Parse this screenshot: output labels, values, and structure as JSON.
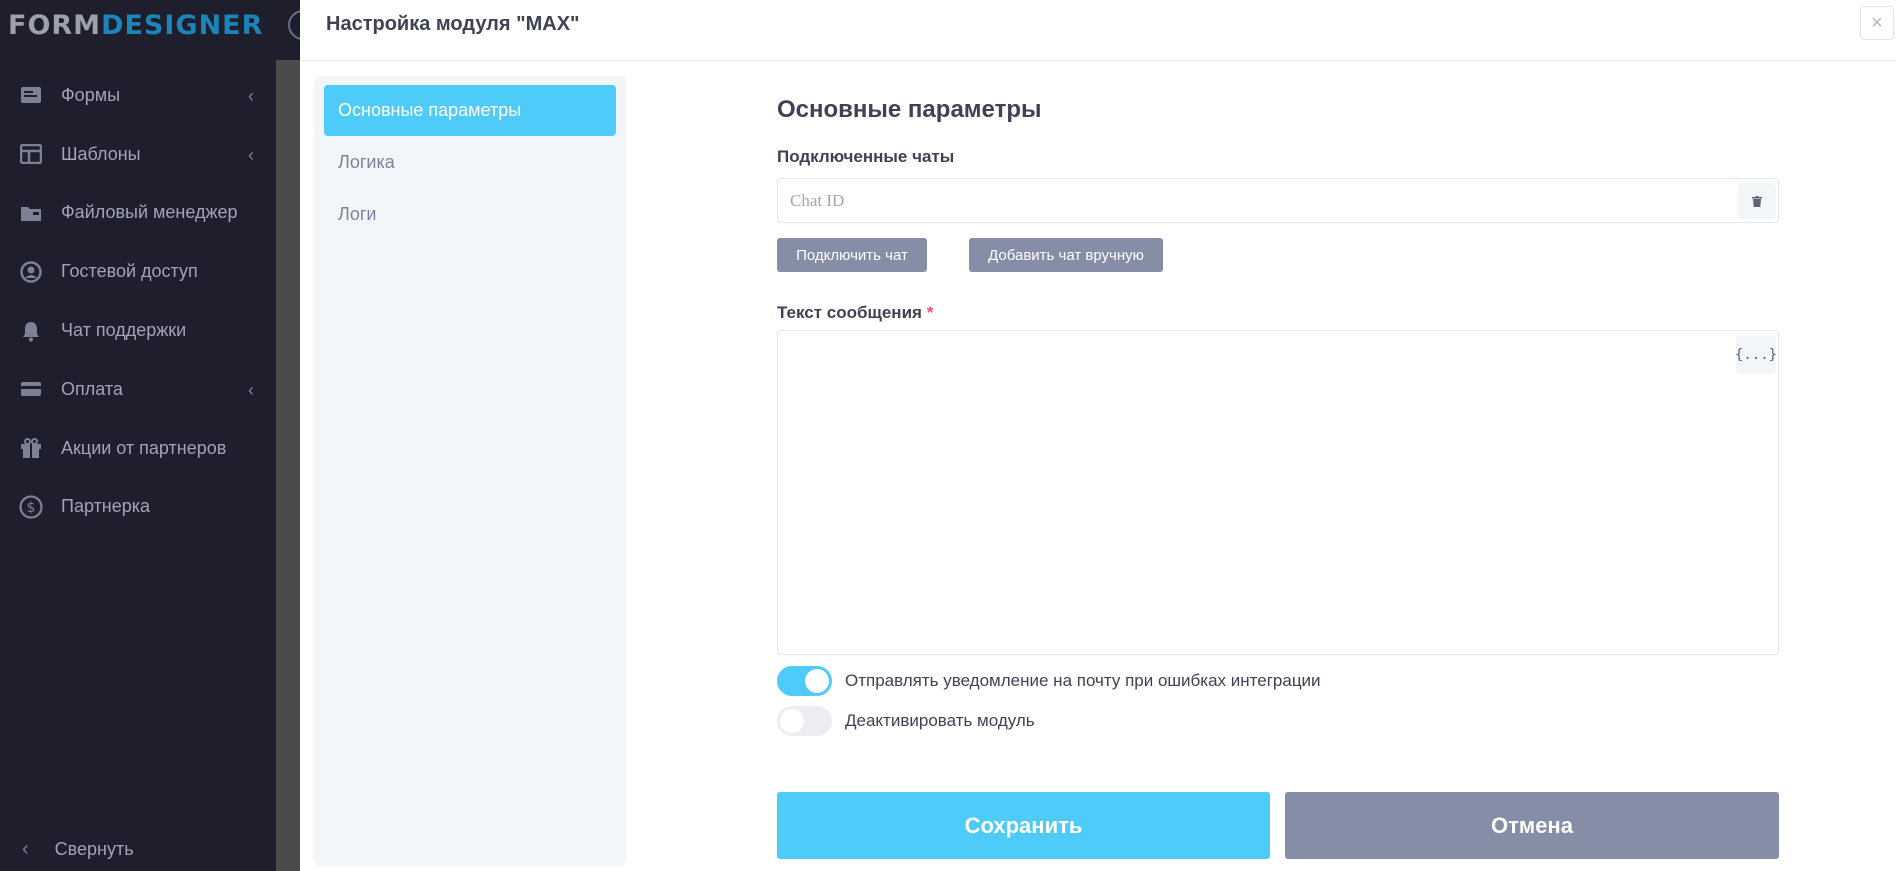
{
  "app": {
    "logo_part1": "FORM",
    "logo_part2": "DESIGNER",
    "nav": [
      {
        "label": "Формы",
        "icon": "forms-icon",
        "has_chevron": true
      },
      {
        "label": "Шаблоны",
        "icon": "templates-icon",
        "has_chevron": true
      },
      {
        "label": "Файловый менеджер",
        "icon": "folder-icon",
        "has_chevron": false
      },
      {
        "label": "Гостевой доступ",
        "icon": "user-icon",
        "has_chevron": false
      },
      {
        "label": "Чат поддержки",
        "icon": "bell-icon",
        "has_chevron": false
      },
      {
        "label": "Оплата",
        "icon": "credit-card-icon",
        "has_chevron": true
      },
      {
        "label": "Акции от партнеров",
        "icon": "gift-icon",
        "has_chevron": false
      },
      {
        "label": "Партнерка",
        "icon": "dollar-icon",
        "has_chevron": false
      }
    ],
    "collapse_label": "Свернуть"
  },
  "modal": {
    "title": "Настройка модуля \"MAX\"",
    "tabs": [
      {
        "label": "Основные параметры",
        "active": true
      },
      {
        "label": "Логика",
        "active": false
      },
      {
        "label": "Логи",
        "active": false
      }
    ],
    "section_title": "Основные параметры",
    "chats_label": "Подключенные чаты",
    "chat_placeholder": "Chat ID",
    "connect_chat_label": "Подключить чат",
    "add_chat_label": "Добавить чат вручную",
    "message_label": "Текст сообщения",
    "required_mark": "*",
    "vars_label": "{...}",
    "message_text": "",
    "toggles": [
      {
        "label": "Отправлять уведомление на почту при ошибках интеграции",
        "on": true
      },
      {
        "label": "Деактивировать модуль",
        "on": false
      }
    ],
    "save_label": "Сохранить",
    "cancel_label": "Отмена"
  },
  "colors": {
    "sidebar_bg": "#1e1e2d",
    "accent": "#4fcbf9",
    "secondary_button": "#858ea6",
    "annotation_arrow": "#cc1111"
  }
}
